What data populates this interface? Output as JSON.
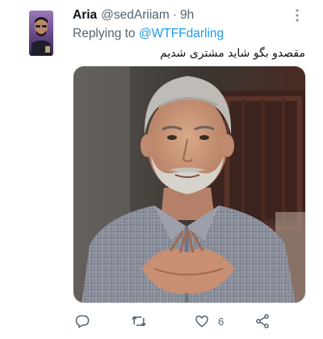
{
  "tweet": {
    "display_name": "Aria",
    "handle": "@sedAriiam",
    "separator": "·",
    "time": "9h",
    "replying_prefix": "Replying to ",
    "replying_to": "@WTFFdarling",
    "text": "مقصدو بگو شاید مشتری شدیم"
  },
  "actions": {
    "like_count": "6",
    "icons": [
      "reply-icon",
      "retweet-icon",
      "like-icon",
      "share-icon",
      "more-icon"
    ]
  },
  "colors": {
    "name": "#0f1419",
    "secondary": "#536471",
    "mention": "#1d9bf0"
  }
}
